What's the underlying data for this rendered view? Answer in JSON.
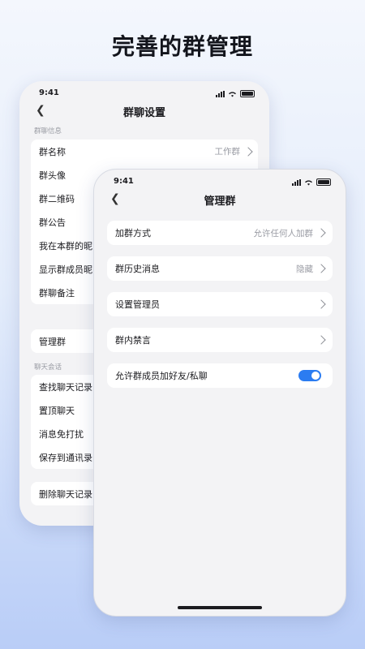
{
  "headline": "完善的群管理",
  "back_phone": {
    "status": {
      "time": "9:41"
    },
    "title": "群聊设置",
    "section_info": "群聊信息",
    "group1": [
      {
        "label": "群名称",
        "value": "工作群",
        "chevron": true
      },
      {
        "label": "群头像",
        "value": "",
        "chevron": false
      },
      {
        "label": "群二维码",
        "value": "",
        "chevron": false
      },
      {
        "label": "群公告",
        "value": "",
        "chevron": false
      },
      {
        "label": "我在本群的昵",
        "value": "",
        "chevron": false
      },
      {
        "label": "显示群成员昵",
        "value": "",
        "chevron": false
      },
      {
        "label": "群聊备注",
        "value": "",
        "chevron": false
      }
    ],
    "admin_row": "管理群",
    "section_chat": "聊天会话",
    "group2": [
      {
        "label": "查找聊天记录"
      },
      {
        "label": "置顶聊天"
      },
      {
        "label": "消息免打扰"
      },
      {
        "label": "保存到通讯录"
      }
    ],
    "delete_row": "删除聊天记录"
  },
  "front_phone": {
    "status": {
      "time": "9:41"
    },
    "title": "管理群",
    "rows": [
      {
        "label": "加群方式",
        "value": "允许任何人加群",
        "chevron": true
      },
      {
        "label": "群历史消息",
        "value": "隐藏",
        "chevron": true
      },
      {
        "label": "设置管理员",
        "value": "",
        "chevron": true
      },
      {
        "label": "群内禁言",
        "value": "",
        "chevron": true
      }
    ],
    "toggle_row": {
      "label": "允许群成员加好友/私聊",
      "enabled": true
    }
  },
  "colors": {
    "accent": "#2b7cf1",
    "bg_top": "#f4f7fd",
    "bg_bottom": "#b9cdf7"
  }
}
